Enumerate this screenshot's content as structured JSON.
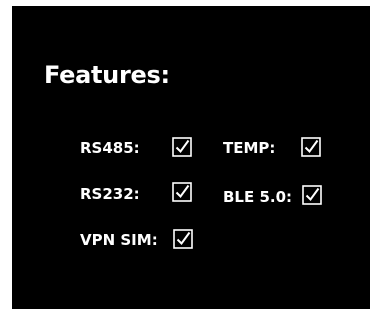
{
  "features": {
    "title": "Features:",
    "items": [
      {
        "label": "RS485:",
        "checked": true
      },
      {
        "label": "TEMP:",
        "checked": true
      },
      {
        "label": "RS232:",
        "checked": true
      },
      {
        "label": "BLE 5.0:",
        "checked": true
      },
      {
        "label": "VPN SIM:",
        "checked": true
      }
    ]
  },
  "colors": {
    "background": "#000000",
    "text": "#ffffff"
  },
  "icons": {
    "check": "checked-box-icon"
  }
}
